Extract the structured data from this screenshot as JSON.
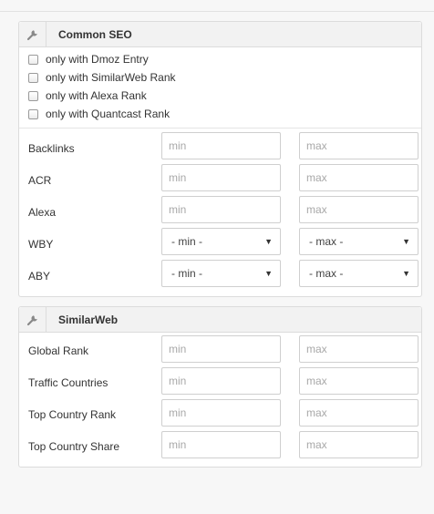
{
  "common_seo": {
    "title": "Common SEO",
    "checkboxes": [
      {
        "label": "only with Dmoz Entry",
        "checked": false
      },
      {
        "label": "only with SimilarWeb Rank",
        "checked": false
      },
      {
        "label": "only with Alexa Rank",
        "checked": false
      },
      {
        "label": "only with Quantcast Rank",
        "checked": false
      }
    ],
    "fields": [
      {
        "label": "Backlinks",
        "min_placeholder": "min",
        "max_placeholder": "max"
      },
      {
        "label": "ACR",
        "min_placeholder": "min",
        "max_placeholder": "max"
      },
      {
        "label": "Alexa",
        "min_placeholder": "min",
        "max_placeholder": "max"
      }
    ],
    "selects": [
      {
        "label": "WBY",
        "min_value": "- min -",
        "max_value": "- max -"
      },
      {
        "label": "ABY",
        "min_value": "- min -",
        "max_value": "- max -"
      }
    ]
  },
  "similarweb": {
    "title": "SimilarWeb",
    "fields": [
      {
        "label": "Global Rank",
        "min_placeholder": "min",
        "max_placeholder": "max"
      },
      {
        "label": "Traffic Countries",
        "min_placeholder": "min",
        "max_placeholder": "max"
      },
      {
        "label": "Top Country Rank",
        "min_placeholder": "min",
        "max_placeholder": "max"
      },
      {
        "label": "Top Country Share",
        "min_placeholder": "min",
        "max_placeholder": "max"
      }
    ]
  },
  "icons": {
    "header_icon": "wrench-icon",
    "select_arrow": "chevron-down-icon"
  }
}
